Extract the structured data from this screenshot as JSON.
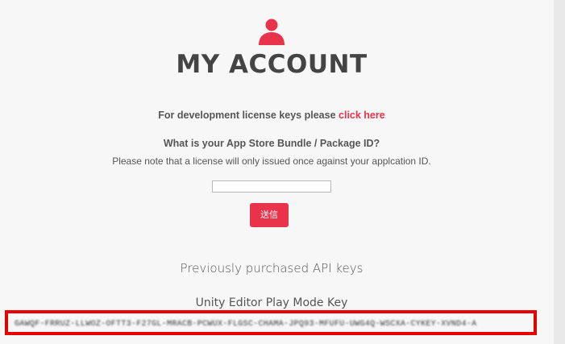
{
  "header": {
    "icon": "user-icon",
    "title": "MY ACCOUNT"
  },
  "dev_keys": {
    "text": "For development license keys please",
    "link_label": "click here"
  },
  "bundle_form": {
    "question": "What is your App Store Bundle / Package ID?",
    "note": "Please note that a license will only issued once against your applcation ID.",
    "input_value": "",
    "submit_label": "送信"
  },
  "purchased": {
    "heading": "Previously purchased API keys",
    "key_label": "Unity Editor Play Mode Key",
    "key_value": "GAWQF-FRRUZ-LLWOZ-OFTT3-F27GL-MRACB-PCWUX-FLGSC-CHAMA-JPQ93-MFUFU-UWG4Q-WSCXA-CYKEY-XVND4-A"
  },
  "colors": {
    "accent": "#e8334a",
    "highlight_border": "#e60000",
    "background": "#f7f7f7"
  }
}
